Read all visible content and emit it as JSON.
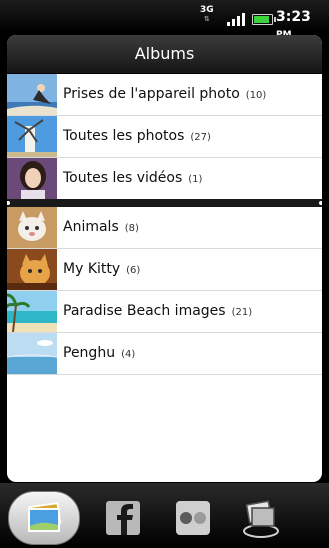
{
  "status_bar": {
    "network": "3G",
    "net_arrows": "⇅",
    "time": "3:23",
    "ampm": "PM",
    "battery_level": 0.9
  },
  "header": {
    "title": "Albums"
  },
  "albums": [
    {
      "name": "Prises de l'appareil photo",
      "count": "(10)"
    },
    {
      "name": "Toutes les photos",
      "count": "(27)"
    },
    {
      "name": "Toutes les vidéos",
      "count": "(1)"
    },
    {
      "name": "Animals",
      "count": "(8)"
    },
    {
      "name": "My Kitty",
      "count": "(6)"
    },
    {
      "name": "Paradise Beach images",
      "count": "(21)"
    },
    {
      "name": "Penghu",
      "count": "(4)"
    }
  ],
  "tabs": [
    {
      "icon": "photo-albums-icon",
      "active": true
    },
    {
      "icon": "facebook-icon",
      "active": false
    },
    {
      "icon": "flickr-icon",
      "active": false
    },
    {
      "icon": "shared-albums-icon",
      "active": false
    }
  ],
  "colors": {
    "battery": "#3ed13e",
    "title_bar": "#2a2a2a",
    "panel": "#ffffff"
  }
}
